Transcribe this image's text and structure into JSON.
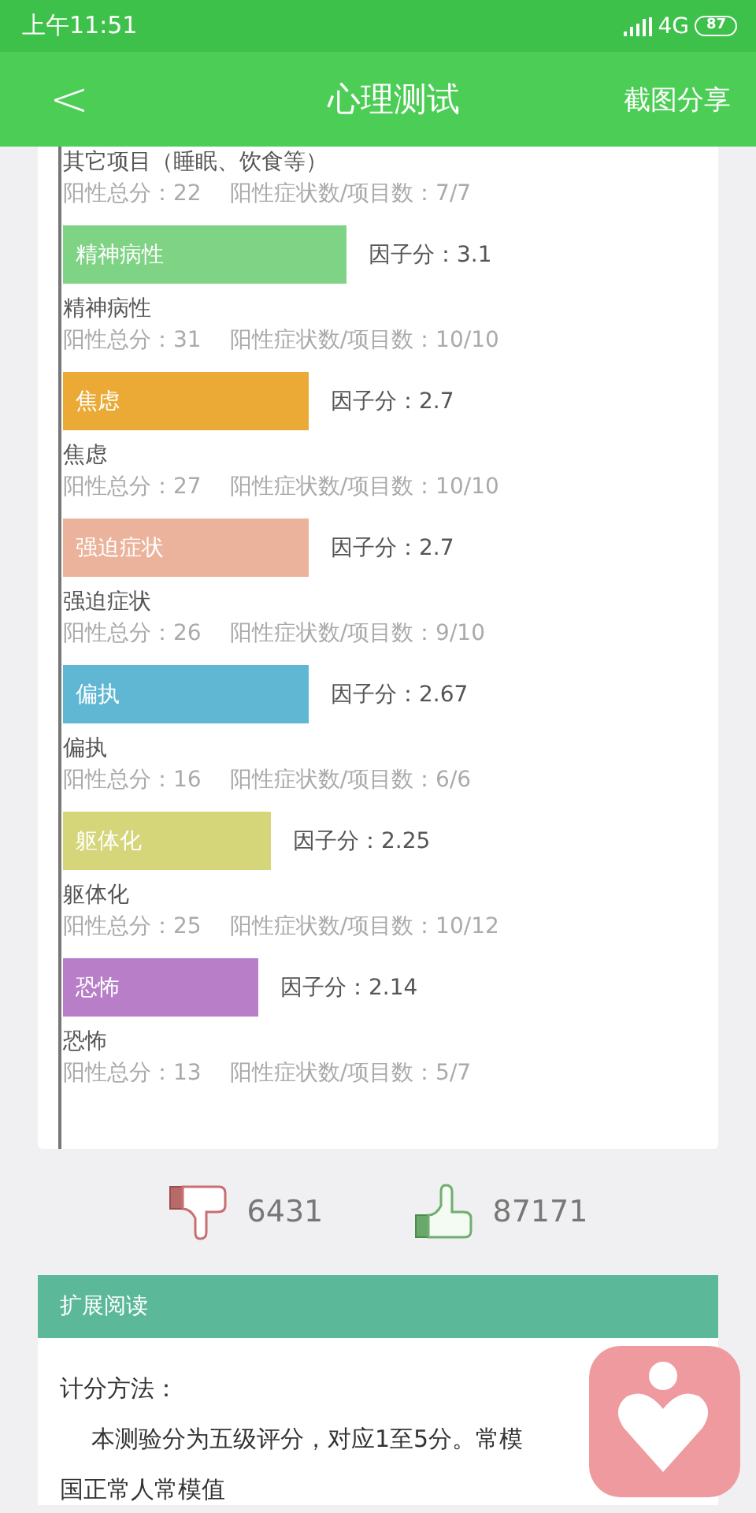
{
  "status_bar": {
    "time": "上午11:51",
    "network": "4G",
    "battery": "87"
  },
  "header": {
    "back": "<",
    "title": "心理测试",
    "action": "截图分享"
  },
  "top_item": {
    "name": "其它项目（睡眠、饮食等）",
    "positive_total": "阳性总分：22",
    "symptoms": "阳性症状数/项目数：7/7"
  },
  "factors": [
    {
      "label": "精神病性",
      "color": "#7fd385",
      "score": "因子分：3.1",
      "name": "精神病性",
      "positive_total": "阳性总分：31",
      "symptoms": "阳性症状数/项目数：10/10"
    },
    {
      "label": "焦虑",
      "color": "#eba935",
      "score": "因子分：2.7",
      "name": "焦虑",
      "positive_total": "阳性总分：27",
      "symptoms": "阳性症状数/项目数：10/10"
    },
    {
      "label": "强迫症状",
      "color": "#ebb39b",
      "score": "因子分：2.7",
      "name": "强迫症状",
      "positive_total": "阳性总分：26",
      "symptoms": "阳性症状数/项目数：9/10"
    },
    {
      "label": "偏执",
      "color": "#5fb7d4",
      "score": "因子分：2.67",
      "name": "偏执",
      "positive_total": "阳性总分：16",
      "symptoms": "阳性症状数/项目数：6/6"
    },
    {
      "label": "躯体化",
      "color": "#d5d57a",
      "score": "因子分：2.25",
      "name": "躯体化",
      "positive_total": "阳性总分：25",
      "symptoms": "阳性症状数/项目数：10/12"
    },
    {
      "label": "恐怖",
      "color": "#b87fc8",
      "score": "因子分：2.14",
      "name": "恐怖",
      "positive_total": "阳性总分：13",
      "symptoms": "阳性症状数/项目数：5/7"
    }
  ],
  "votes": {
    "dislikes": "6431",
    "likes": "87171"
  },
  "reading": {
    "title": "扩展阅读",
    "heading": "计分方法：",
    "lines": [
      "本测验分为五级评分，对应1至5分。常模",
      "国正常人常模值"
    ]
  }
}
